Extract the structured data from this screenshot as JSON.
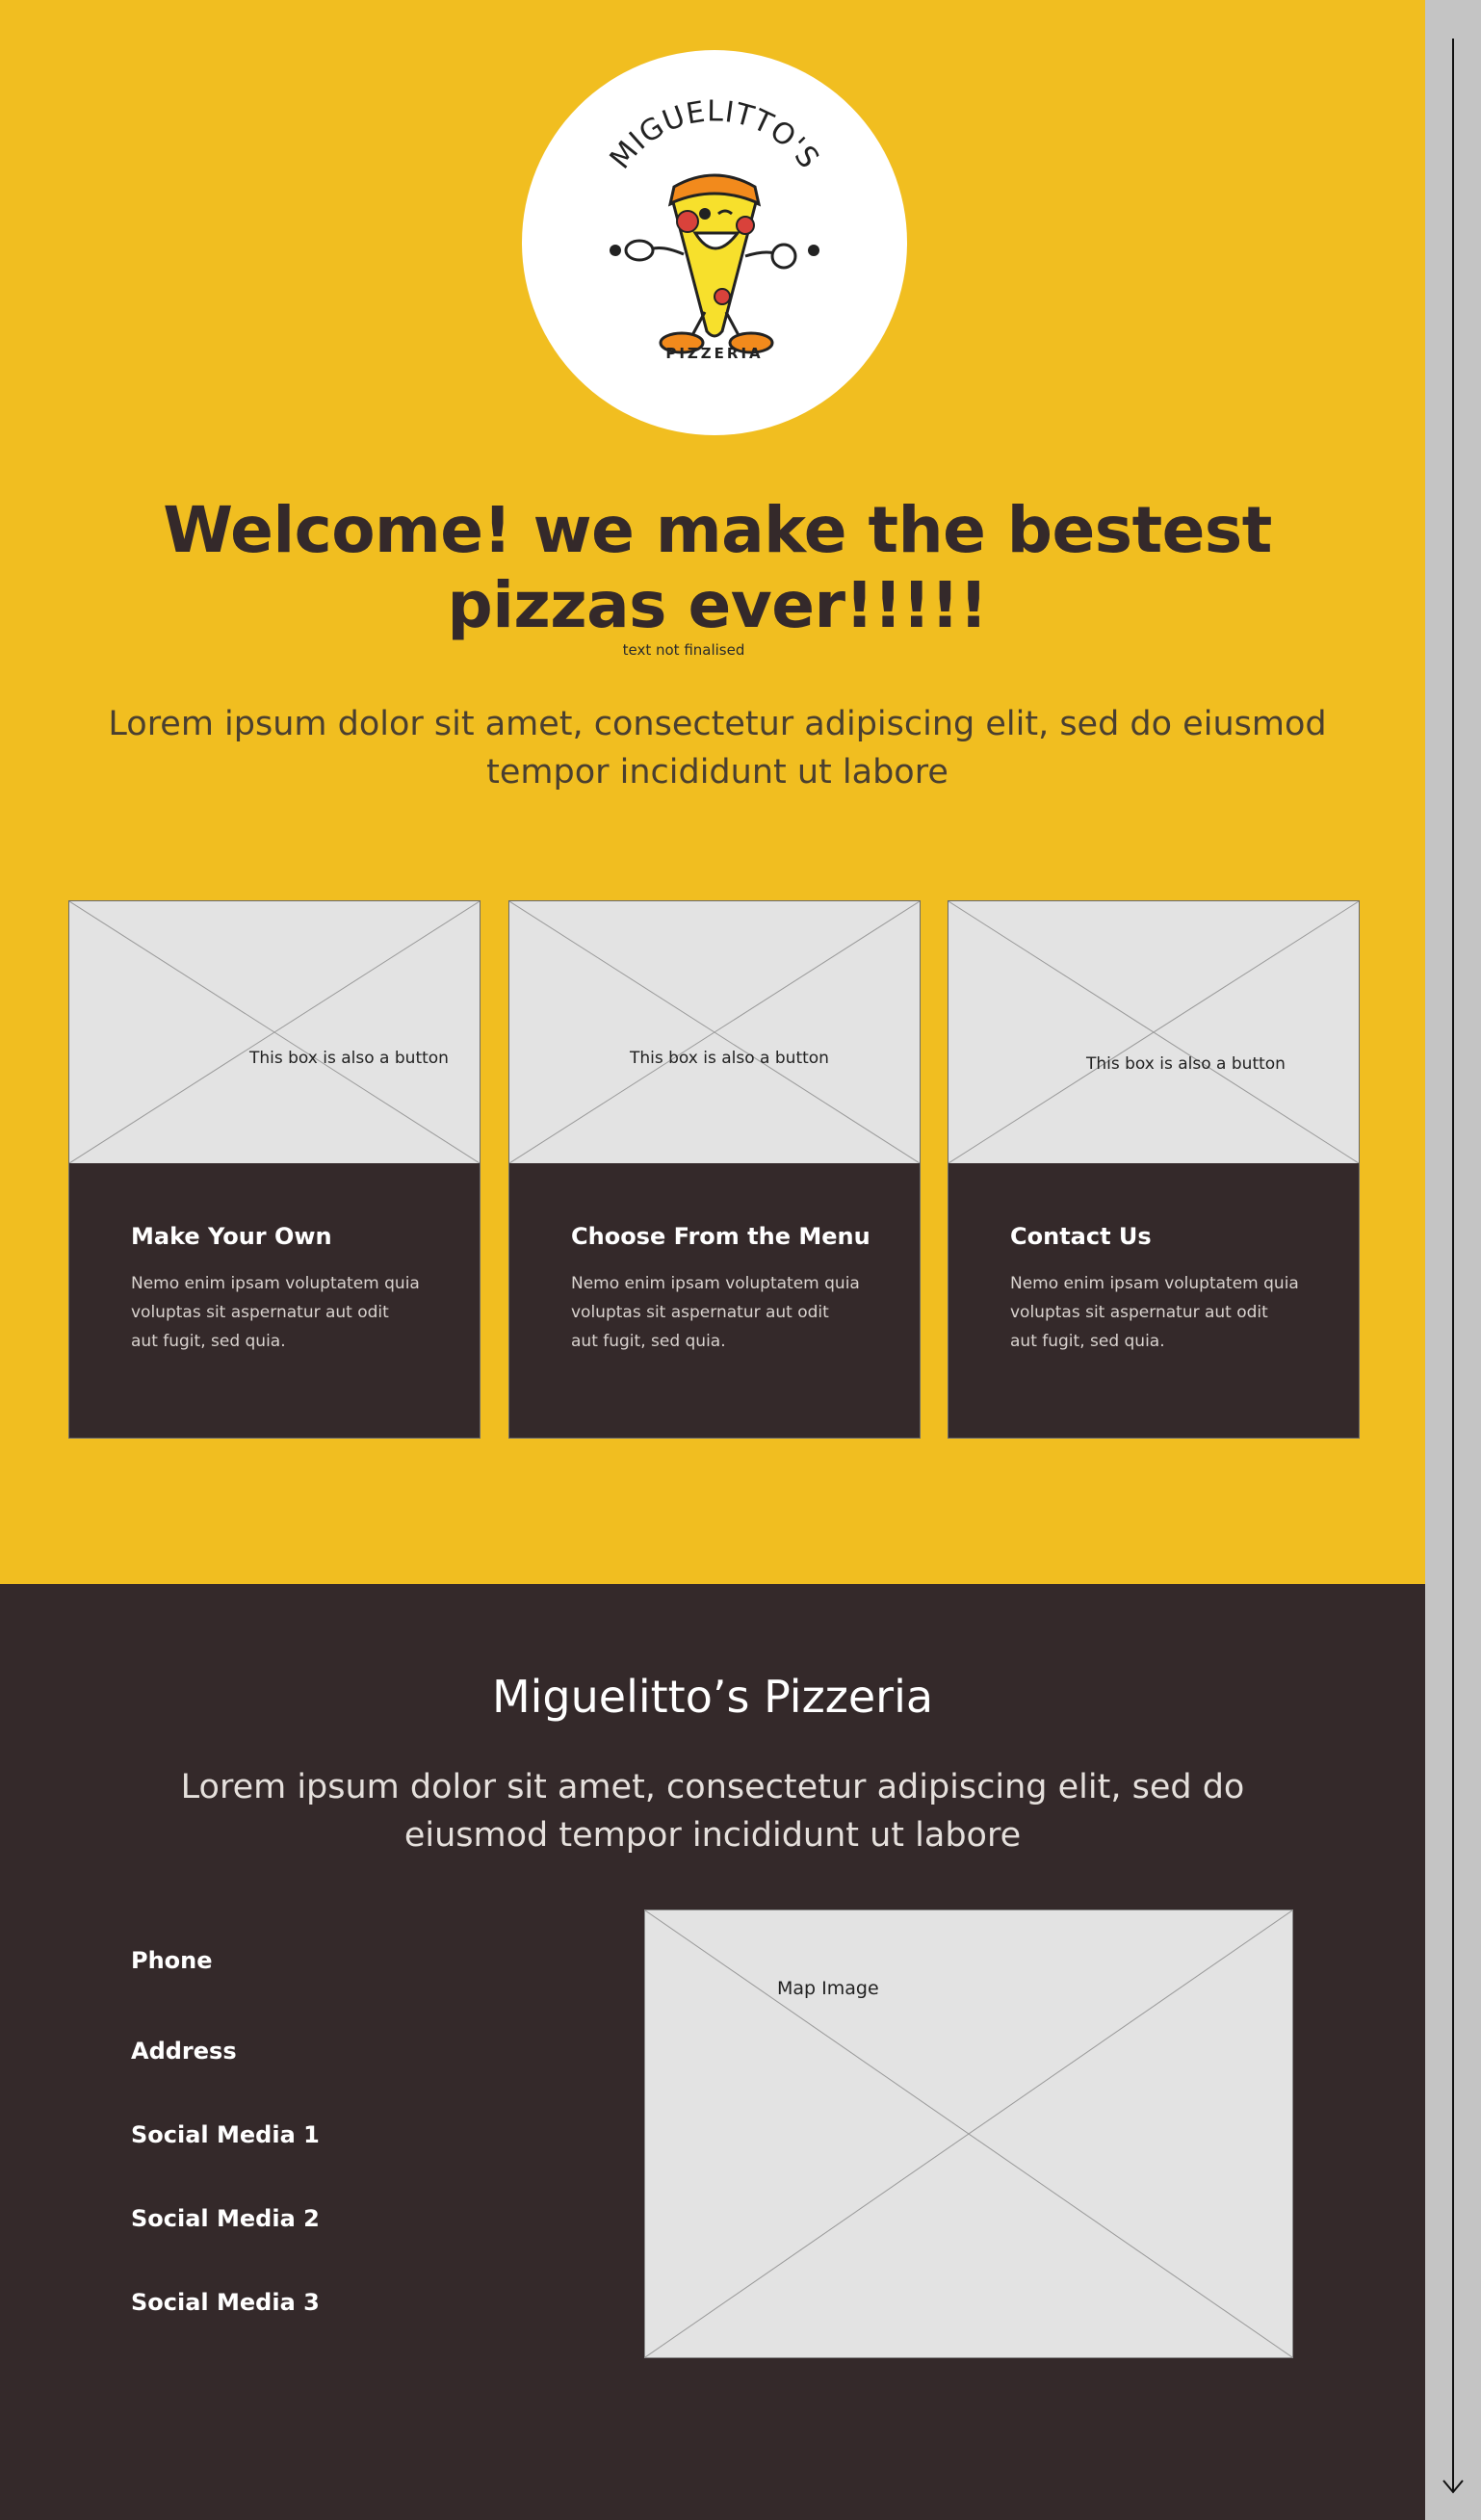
{
  "colors": {
    "hero_bg": "#f1be20",
    "dark_bg": "#34292a",
    "placeholder_bg": "#e3e3e3",
    "scrollbar_bg": "#c4c4c4",
    "logo_orange": "#f28a1c",
    "logo_yellow": "#f7e02c",
    "logo_red": "#d9423b"
  },
  "logo": {
    "brand": "MIGUELITTO'S",
    "subtitle": "PIZZERIA",
    "icon": "pizza-mascot-icon"
  },
  "hero": {
    "title": "Welcome! we make the bestest pizzas ever!!!!!",
    "note": "text not finalised",
    "subtitle": "Lorem ipsum dolor sit amet, consectetur adipiscing elit, sed do eiusmod tempor incididunt ut labore"
  },
  "cards": [
    {
      "image_label": "This box is also a button",
      "title": "Make Your Own",
      "text": "Nemo enim ipsam voluptatem quia voluptas sit aspernatur aut odit aut fugit, sed quia."
    },
    {
      "image_label": "This box is also a button",
      "title": "Choose From the Menu",
      "text": "Nemo enim ipsam voluptatem quia voluptas sit aspernatur aut odit aut fugit, sed quia."
    },
    {
      "image_label": "This box is also a button",
      "title": "Contact Us",
      "text": "Nemo enim ipsam voluptatem quia voluptas sit aspernatur aut odit aut fugit, sed quia."
    }
  ],
  "footer": {
    "title": "Miguelitto’s Pizzeria",
    "subtitle": "Lorem ipsum dolor sit amet, consectetur adipiscing elit, sed do eiusmod tempor incididunt ut labore",
    "contacts": [
      "Phone",
      "Address",
      "Social Media 1",
      "Social Media 2",
      "Social Media 3"
    ],
    "map_label": "Map Image"
  },
  "scrollbar": {
    "icon": "scroll-down-arrow-icon"
  }
}
